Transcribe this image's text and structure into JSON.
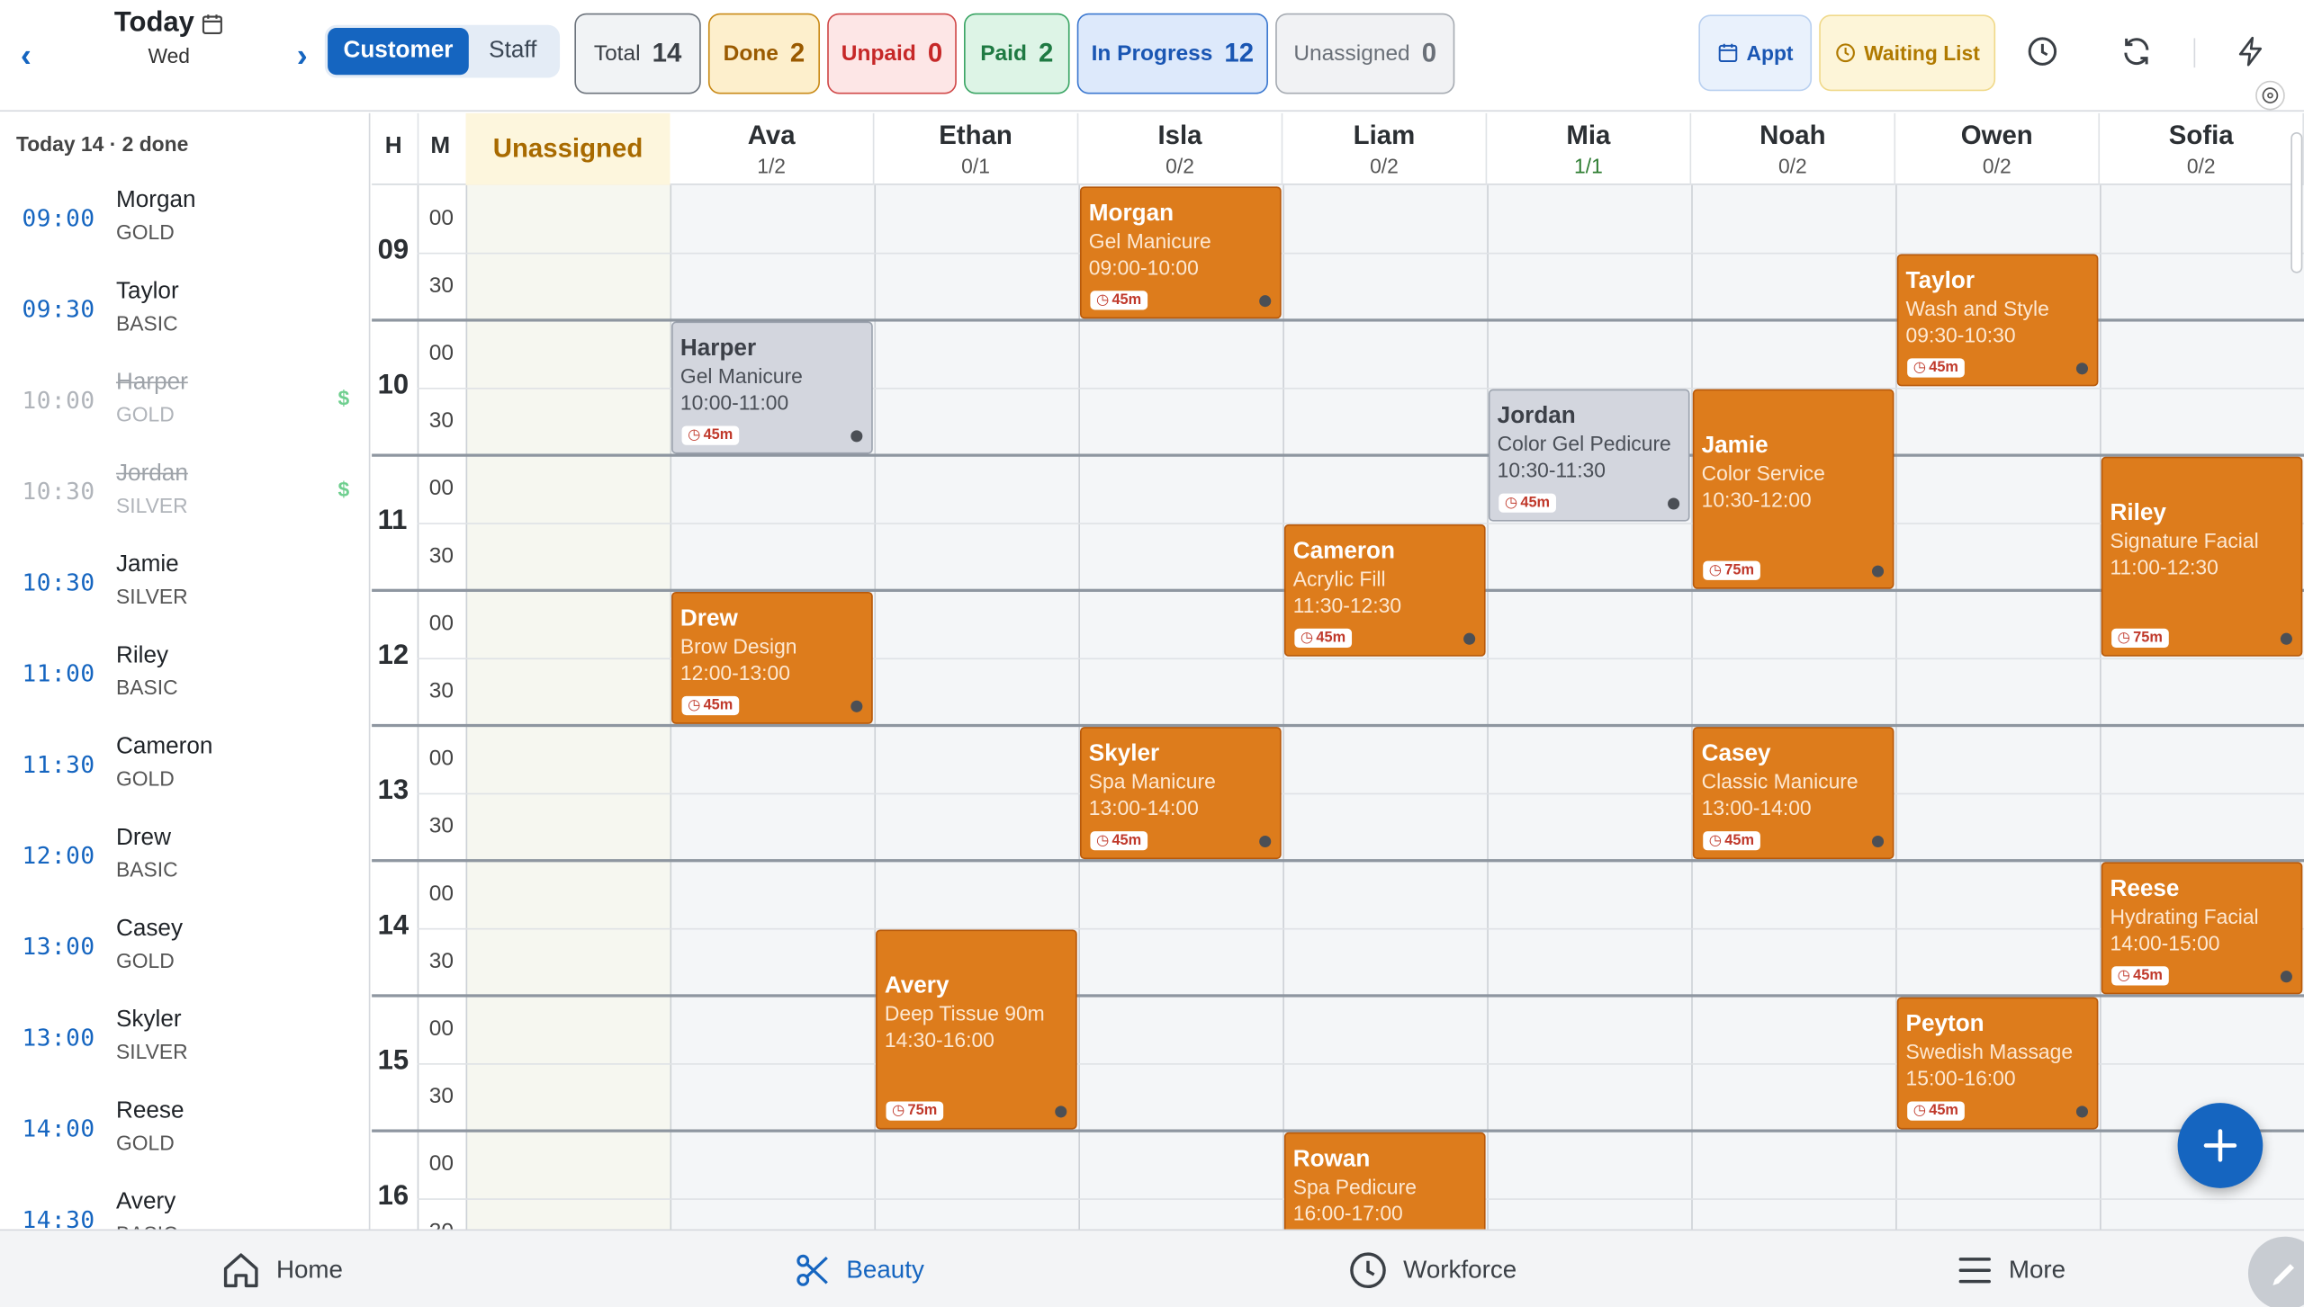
{
  "header": {
    "date_title": "Today",
    "date_sub": "Wed",
    "seg": {
      "customer": "Customer",
      "staff": "Staff"
    },
    "stats": {
      "total_label": "Total",
      "total_val": "14",
      "done_label": "Done",
      "done_val": "2",
      "unpaid_label": "Unpaid",
      "unpaid_val": "0",
      "paid_label": "Paid",
      "paid_val": "2",
      "progress_label": "In Progress",
      "progress_val": "12",
      "unassigned_label": "Unassigned",
      "unassigned_val": "0"
    },
    "appt_label": "Appt",
    "waiting_label": "Waiting List"
  },
  "sidebar": {
    "summary": "Today 14 · 2 done",
    "items": [
      {
        "time": "09:00",
        "name": "Morgan",
        "tier": "GOLD",
        "done": false,
        "paid": ""
      },
      {
        "time": "09:30",
        "name": "Taylor",
        "tier": "BASIC",
        "done": false,
        "paid": ""
      },
      {
        "time": "10:00",
        "name": "Harper",
        "tier": "GOLD",
        "done": true,
        "paid": "$"
      },
      {
        "time": "10:30",
        "name": "Jordan",
        "tier": "SILVER",
        "done": true,
        "paid": "$"
      },
      {
        "time": "10:30",
        "name": "Jamie",
        "tier": "SILVER",
        "done": false,
        "paid": ""
      },
      {
        "time": "11:00",
        "name": "Riley",
        "tier": "BASIC",
        "done": false,
        "paid": ""
      },
      {
        "time": "11:30",
        "name": "Cameron",
        "tier": "GOLD",
        "done": false,
        "paid": ""
      },
      {
        "time": "12:00",
        "name": "Drew",
        "tier": "BASIC",
        "done": false,
        "paid": ""
      },
      {
        "time": "13:00",
        "name": "Casey",
        "tier": "GOLD",
        "done": false,
        "paid": ""
      },
      {
        "time": "13:00",
        "name": "Skyler",
        "tier": "SILVER",
        "done": false,
        "paid": ""
      },
      {
        "time": "14:00",
        "name": "Reese",
        "tier": "GOLD",
        "done": false,
        "paid": ""
      },
      {
        "time": "14:30",
        "name": "Avery",
        "tier": "BASIC",
        "done": false,
        "paid": ""
      }
    ]
  },
  "grid": {
    "h_label": "H",
    "m_label": "M",
    "unassigned_label": "Unassigned",
    "staff": [
      {
        "name": "Ava",
        "count": "1/2"
      },
      {
        "name": "Ethan",
        "count": "0/1"
      },
      {
        "name": "Isla",
        "count": "0/2"
      },
      {
        "name": "Liam",
        "count": "0/2"
      },
      {
        "name": "Mia",
        "count": "1/1"
      },
      {
        "name": "Noah",
        "count": "0/2"
      },
      {
        "name": "Owen",
        "count": "0/2"
      },
      {
        "name": "Sofia",
        "count": "0/2"
      }
    ],
    "hours": [
      "09",
      "10",
      "11",
      "12",
      "13",
      "14",
      "15",
      "16"
    ],
    "minutes": [
      "00",
      "30"
    ],
    "appointments": [
      {
        "name": "Morgan",
        "service": "Gel Manicure",
        "time": "09:00-10:00",
        "dur": "45m",
        "staff": "Isla",
        "status": "active"
      },
      {
        "name": "Taylor",
        "service": "Wash and Style",
        "time": "09:30-10:30",
        "dur": "45m",
        "staff": "Owen",
        "status": "active"
      },
      {
        "name": "Harper",
        "service": "Gel Manicure",
        "time": "10:00-11:00",
        "dur": "45m",
        "staff": "Ava",
        "status": "done"
      },
      {
        "name": "Jordan",
        "service": "Color Gel Pedicure",
        "time": "10:30-11:30",
        "dur": "45m",
        "staff": "Mia",
        "status": "done"
      },
      {
        "name": "Jamie",
        "service": "Color Service",
        "time": "10:30-12:00",
        "dur": "75m",
        "staff": "Noah",
        "status": "active"
      },
      {
        "name": "Riley",
        "service": "Signature Facial",
        "time": "11:00-12:30",
        "dur": "75m",
        "staff": "Sofia",
        "status": "active"
      },
      {
        "name": "Cameron",
        "service": "Acrylic Fill",
        "time": "11:30-12:30",
        "dur": "45m",
        "staff": "Liam",
        "status": "active"
      },
      {
        "name": "Drew",
        "service": "Brow Design",
        "time": "12:00-13:00",
        "dur": "45m",
        "staff": "Ava",
        "status": "active"
      },
      {
        "name": "Skyler",
        "service": "Spa Manicure",
        "time": "13:00-14:00",
        "dur": "45m",
        "staff": "Isla",
        "status": "active"
      },
      {
        "name": "Casey",
        "service": "Classic Manicure",
        "time": "13:00-14:00",
        "dur": "45m",
        "staff": "Noah",
        "status": "active"
      },
      {
        "name": "Reese",
        "service": "Hydrating Facial",
        "time": "14:00-15:00",
        "dur": "45m",
        "staff": "Sofia",
        "status": "active"
      },
      {
        "name": "Avery",
        "service": "Deep Tissue 90m",
        "time": "14:30-16:00",
        "dur": "75m",
        "staff": "Ethan",
        "status": "active"
      },
      {
        "name": "Peyton",
        "service": "Swedish Massage",
        "time": "15:00-16:00",
        "dur": "45m",
        "staff": "Owen",
        "status": "active"
      },
      {
        "name": "Rowan",
        "service": "Spa Pedicure",
        "time": "16:00-17:00",
        "dur": "",
        "staff": "Liam",
        "status": "active"
      }
    ]
  },
  "bottom": {
    "home": "Home",
    "beauty": "Beauty",
    "workforce": "Workforce",
    "more": "More"
  },
  "colors": {
    "accent": "#1565c0",
    "appt": "#dd7c1c",
    "done_appt": "#d3d6de",
    "paid_green": "#2e7d32",
    "unassigned_gold": "#a86a00"
  }
}
